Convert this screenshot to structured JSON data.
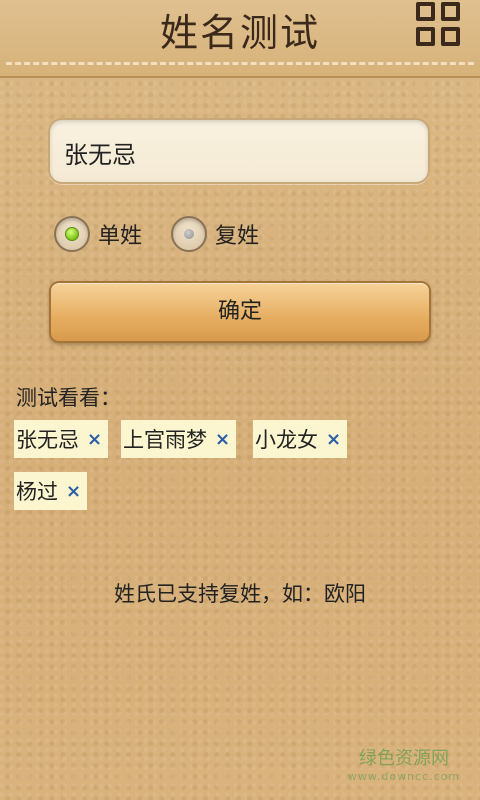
{
  "header": {
    "title": "姓名测试",
    "menu_icon": "grid-menu-icon"
  },
  "form": {
    "name_value": "张无忌",
    "radio_single_label": "单姓",
    "radio_compound_label": "复姓",
    "selected": "single",
    "confirm_label": "确定"
  },
  "examples": {
    "heading": "测试看看：",
    "tags": [
      {
        "label": "张无忌",
        "remove": "×"
      },
      {
        "label": "上官雨梦",
        "remove": "×"
      },
      {
        "label": "小龙女",
        "remove": "×"
      },
      {
        "label": "杨过",
        "remove": "×"
      }
    ]
  },
  "hint": "姓氏已支持复姓，如：欧阳",
  "watermark": {
    "text": "绿色资源网",
    "sub": "www.downcc.com"
  },
  "colors": {
    "accent_green": "#7dc218",
    "tag_bg": "#fbf6cf",
    "close_blue": "#2a5ea8",
    "button_orange": "#e6ae62"
  }
}
